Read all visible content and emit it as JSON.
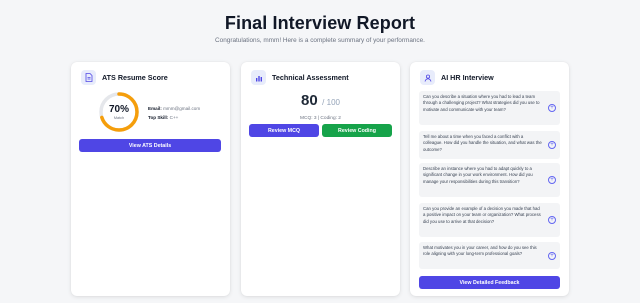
{
  "page": {
    "title": "Final Interview Report",
    "subtitle": "Congratulations, mmm! Here is a complete summary of your performance."
  },
  "ats": {
    "title": "ATS Resume Score",
    "score_text": "70%",
    "score_fraction": 0.7,
    "score_label": "Match",
    "email_label": "Email:",
    "email_value": "mmm@gmail.com",
    "skill_label": "Top Skill:",
    "skill_value": "C++",
    "button": "View ATS Details",
    "icon": "document-icon",
    "accent": "#f59e0b"
  },
  "tech": {
    "title": "Technical Assessment",
    "score": "80",
    "max": "/ 100",
    "sub": "MCQ: 3 | Coding: 2",
    "btn_mcq": "Review MCQ",
    "btn_coding": "Review Coding",
    "icon": "bar-chart-icon"
  },
  "hr": {
    "title": "AI HR Interview",
    "icon": "user-icon",
    "questions": [
      "Can you describe a situation where you had to lead a team through a challenging project? What strategies did you use to motivate and communicate with your team?",
      "Tell me about a time when you faced a conflict with a colleague. How did you handle the situation, and what was the outcome?",
      "Describe an instance where you had to adapt quickly to a significant change in your work environment. How did you manage your responsibilities during this transition?",
      "Can you provide an example of a decision you made that had a positive impact on your team or organization? What process did you use to arrive at that decision?",
      "What motivates you in your career, and how do you see this role aligning with your long-term professional goals?"
    ],
    "button": "View Detailed Feedback"
  },
  "colors": {
    "primary": "#4f46e5",
    "success": "#16a34a",
    "gauge": "#f59e0b"
  }
}
